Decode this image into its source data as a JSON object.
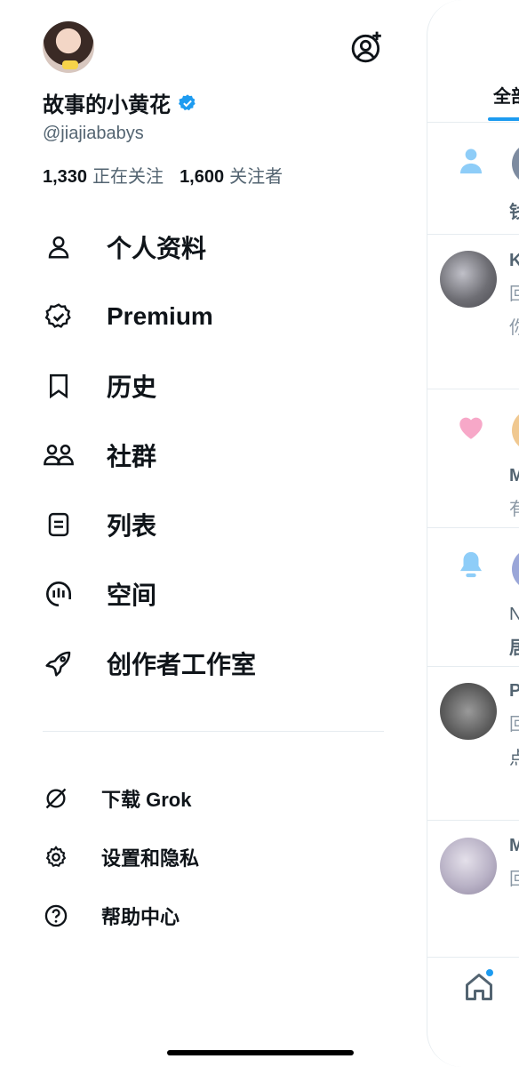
{
  "profile": {
    "name": "故事的小黄花",
    "handle": "@jiajiababys",
    "following_count": "1,330",
    "following_label": "正在关注",
    "followers_count": "1,600",
    "followers_label": "关注者",
    "verified": true
  },
  "menu": {
    "items": [
      {
        "label": "个人资料",
        "icon": "person-icon"
      },
      {
        "label": "Premium",
        "icon": "premium-badge-icon"
      },
      {
        "label": "历史",
        "icon": "bookmark-icon"
      },
      {
        "label": "社群",
        "icon": "communities-icon"
      },
      {
        "label": "列表",
        "icon": "list-icon"
      },
      {
        "label": "空间",
        "icon": "spaces-icon"
      },
      {
        "label": "创作者工作室",
        "icon": "rocket-icon"
      }
    ],
    "secondary": [
      {
        "label": "下载 Grok",
        "icon": "grok-icon"
      },
      {
        "label": "设置和隐私",
        "icon": "gear-icon"
      },
      {
        "label": "帮助中心",
        "icon": "help-icon"
      }
    ]
  },
  "panel": {
    "tab_label": "全部",
    "rows": [
      {
        "text": "钱"
      },
      {
        "text": "K"
      },
      {
        "text": "回"
      },
      {
        "text": "你"
      },
      {
        "text": "M"
      },
      {
        "text": "有"
      },
      {
        "text": "N"
      },
      {
        "text": "居"
      },
      {
        "text": "P"
      },
      {
        "text": "回"
      },
      {
        "text": "点"
      },
      {
        "text": "M"
      },
      {
        "text": "回"
      }
    ]
  },
  "colors": {
    "accent": "#1d9bf0",
    "like": "#f7a8c8",
    "notify": "#8ecdf8"
  }
}
